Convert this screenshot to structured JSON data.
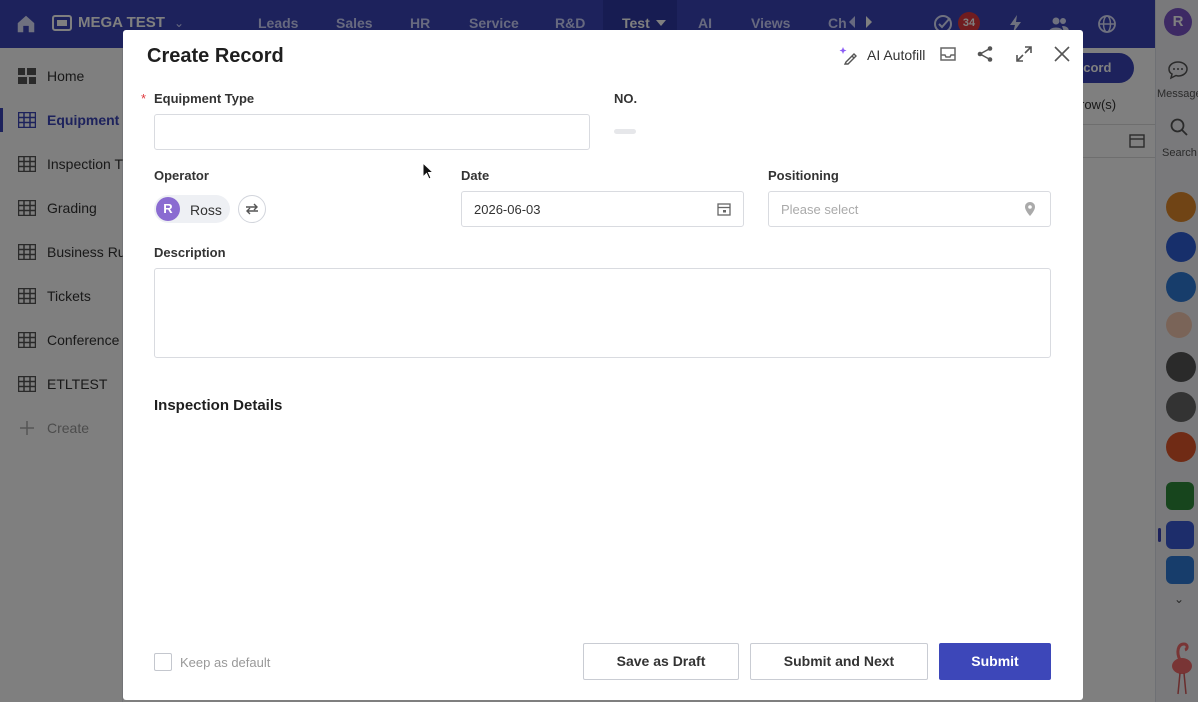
{
  "topbar": {
    "app_name": "MEGA TEST",
    "tabs": [
      {
        "label": "Leads"
      },
      {
        "label": "Sales"
      },
      {
        "label": "HR"
      },
      {
        "label": "Service"
      },
      {
        "label": "R&D"
      },
      {
        "label": "Test"
      },
      {
        "label": "AI"
      },
      {
        "label": "Views"
      },
      {
        "label": "Ch"
      }
    ],
    "badge_count": "34",
    "accent": "#3a44b8"
  },
  "sidebar": {
    "items": [
      {
        "label": "Home",
        "icon": "home-grid-icon"
      },
      {
        "label": "Equipment",
        "icon": "table-icon"
      },
      {
        "label": "Inspection T",
        "icon": "table-icon"
      },
      {
        "label": "Grading",
        "icon": "table-icon"
      },
      {
        "label": "Business Ru",
        "icon": "table-icon"
      },
      {
        "label": "Tickets",
        "icon": "table-icon"
      },
      {
        "label": "Conference",
        "icon": "table-icon"
      },
      {
        "label": "ETLTEST",
        "icon": "table-icon"
      }
    ],
    "create_label": "Create"
  },
  "background": {
    "record_button": "ecord",
    "rows_text": "row(s)"
  },
  "rail": {
    "user_initial": "R",
    "message_label": "Message",
    "search_label": "Search"
  },
  "modal": {
    "title": "Create Record",
    "ai_autofill": "AI Autofill",
    "fields": {
      "equipment_type_label": "Equipment Type",
      "equipment_type_value": "",
      "no_label": "NO.",
      "operator_label": "Operator",
      "operator_initial": "R",
      "operator_name": "Ross",
      "date_label": "Date",
      "date_value": "2026-06-03",
      "positioning_label": "Positioning",
      "positioning_placeholder": "Please select",
      "description_label": "Description",
      "description_value": ""
    },
    "section_title": "Inspection Details",
    "footer": {
      "keep_default": "Keep as default",
      "save_draft": "Save as Draft",
      "submit_next": "Submit and Next",
      "submit": "Submit"
    }
  }
}
